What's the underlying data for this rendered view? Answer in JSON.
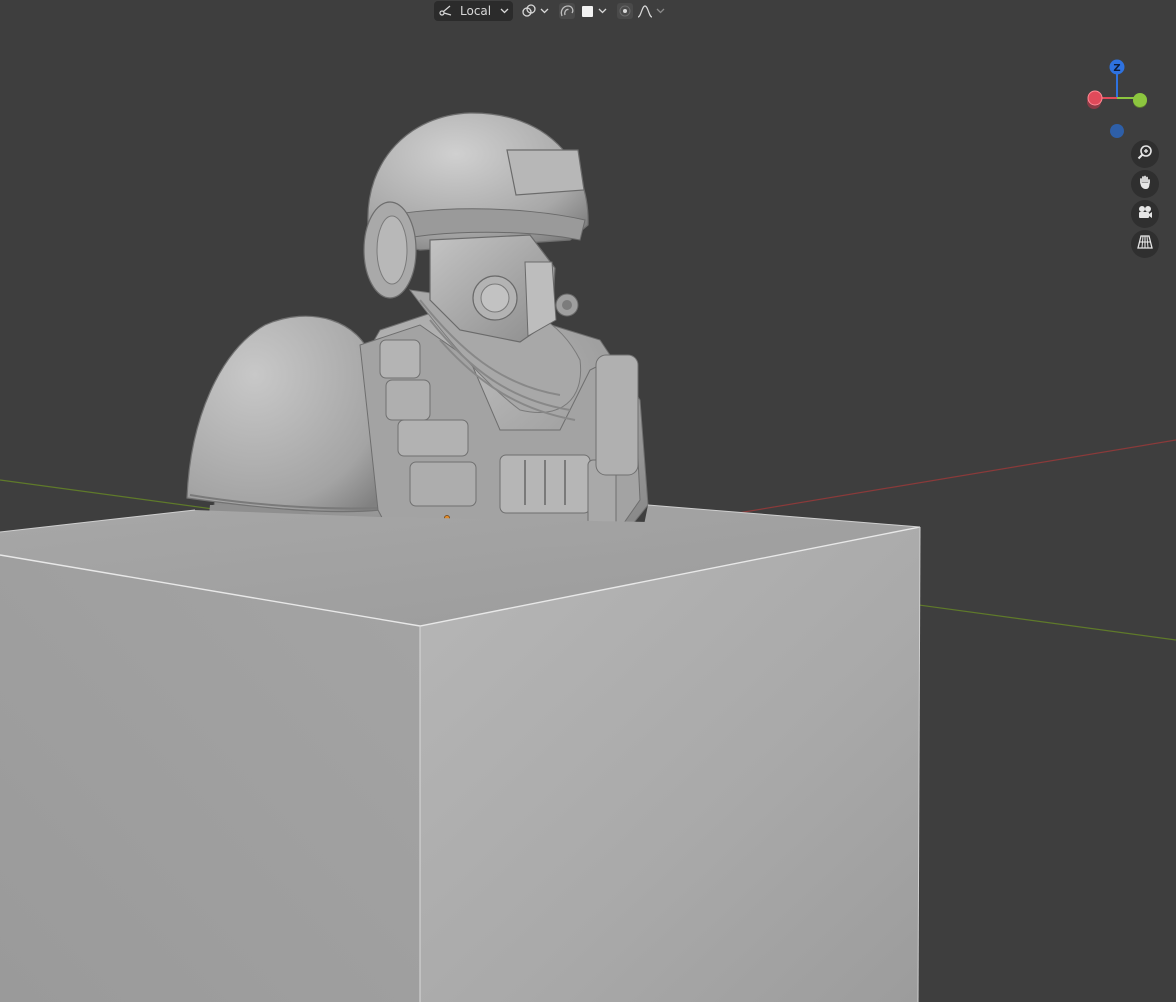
{
  "header_toolbar": {
    "transform_orientation": {
      "icon": "transform-orientation-icon",
      "selected": "Local"
    },
    "pivot_icon": "pivot-point-icon",
    "snap_icon": "snap-icon",
    "proportional_edit_icon": "proportional-editing-icon",
    "falloff_icon": "falloff-curve-icon",
    "shading_swatch_color": "#f2f2f2"
  },
  "gizmo": {
    "axes": [
      {
        "name": "Z",
        "color": "#2e72e0",
        "label": "Z"
      },
      {
        "name": "Y",
        "color": "#8cc63f",
        "label": ""
      },
      {
        "name": "X",
        "color": "#e04a5a",
        "label": ""
      },
      {
        "name": "-Z",
        "color": "#2e5fa8",
        "label": ""
      }
    ]
  },
  "nav_buttons": [
    {
      "name": "zoom-icon"
    },
    {
      "name": "pan-hand-icon"
    },
    {
      "name": "camera-icon"
    },
    {
      "name": "perspective-grid-icon"
    }
  ],
  "scene": {
    "background": "#3e3e3e",
    "x_axis_color": "#8a3a3a",
    "y_axis_color": "#5f7a2a",
    "object_color": "#b9b9b9"
  }
}
